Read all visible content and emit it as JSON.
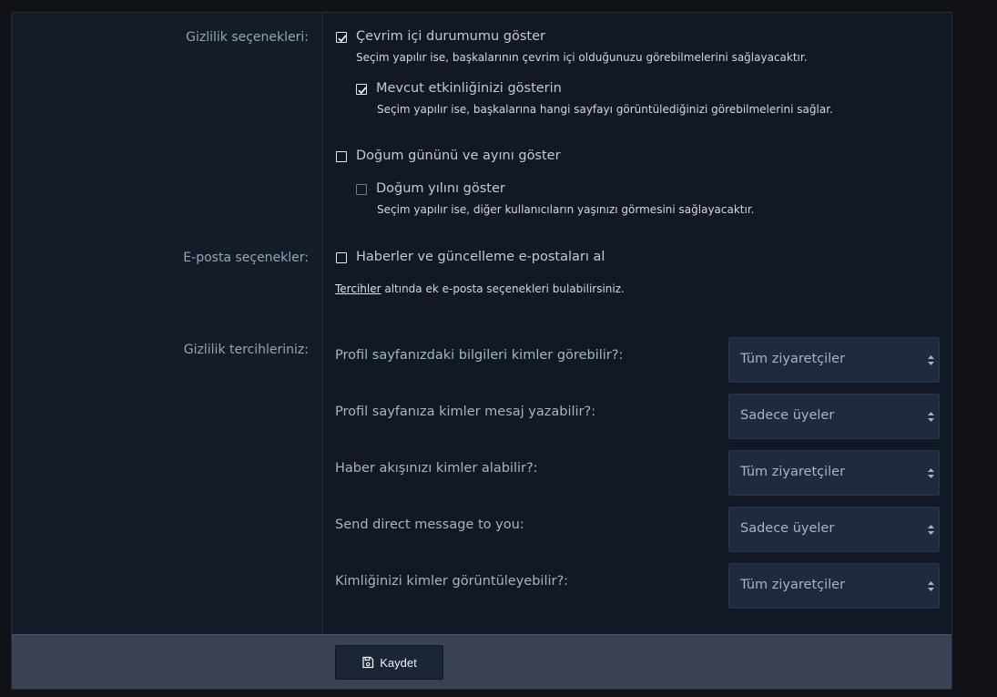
{
  "privacy_options": {
    "label": "Gizlilik seçenekleri:",
    "show_online": {
      "label": "Çevrim içi durumumu göster",
      "hint": "Seçim yapılır ise, başkalarının çevrim içi olduğunuzu görebilmelerini sağlayacaktır.",
      "checked": true
    },
    "show_activity": {
      "label": "Mevcut etkinliğinizi gösterin",
      "hint": "Seçim yapılır ise, başkalarına hangi sayfayı görüntülediğinizi görebilmelerini sağlar.",
      "checked": true
    },
    "show_dob": {
      "label": "Doğum gününü ve ayını göster",
      "checked": false
    },
    "show_year": {
      "label": "Doğum yılını göster",
      "hint": "Seçim yapılır ise, diğer kullanıcıların yaşınızı görmesini sağlayacaktır.",
      "checked": false
    }
  },
  "email_options": {
    "label": "E-posta seçenekler:",
    "news": {
      "label": "Haberler ve güncelleme e-postaları al",
      "checked": false
    },
    "prefs_link": "Tercihler",
    "prefs_text": " altında ek e-posta seçenekleri bulabilirsiniz."
  },
  "privacy_prefs": {
    "label": "Gizlilik tercihleriniz:",
    "items": [
      {
        "question": "Profil sayfanızdaki bilgileri kimler görebilir?:",
        "value": "Tüm ziyaretçiler"
      },
      {
        "question": "Profil sayfanıza kimler mesaj yazabilir?:",
        "value": "Sadece üyeler"
      },
      {
        "question": "Haber akışınızı kimler alabilir?:",
        "value": "Tüm ziyaretçiler"
      },
      {
        "question": "Send direct message to you:",
        "value": "Sadece üyeler"
      },
      {
        "question": "Kimliğinizi kimler görüntüleyebilir?:",
        "value": "Tüm ziyaretçiler"
      }
    ]
  },
  "footer": {
    "save_label": "Kaydet"
  },
  "colors": {
    "panel_bg": "#111826",
    "label_bg": "#141c2a",
    "select_bg": "#1e2a3d",
    "footer_bg": "#3a4152"
  }
}
